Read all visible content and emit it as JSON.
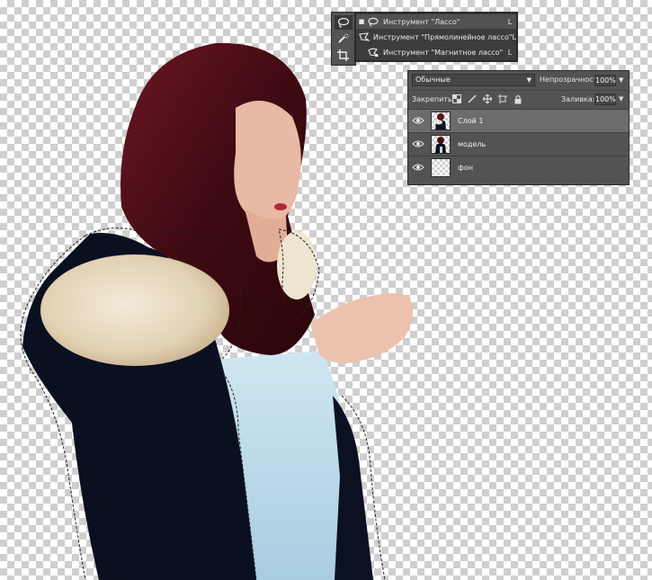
{
  "colors": {
    "panel_bg": "#535353",
    "flyout_bg": "#3c3c3c",
    "selected_layer_bg": "#6c6c6c",
    "text": "#e6e6e6"
  },
  "tool_strip": {
    "tools": [
      {
        "icon": "lasso-icon",
        "active": true
      },
      {
        "icon": "quick-selection-brush-icon",
        "active": false
      },
      {
        "icon": "crop-icon",
        "active": false
      }
    ]
  },
  "flyout": {
    "items": [
      {
        "label": "Инструмент \"Лассо\"",
        "shortcut": "L",
        "icon": "lasso-icon",
        "selected": true,
        "bullet": "■"
      },
      {
        "label": "Инструмент \"Прямолинейное лассо\"",
        "shortcut": "L",
        "icon": "polygonal-lasso-icon",
        "selected": false,
        "bullet": ""
      },
      {
        "label": "Инструмент \"Магнитное лассо\"",
        "shortcut": "L",
        "icon": "magnetic-lasso-icon",
        "selected": false,
        "bullet": ""
      }
    ]
  },
  "layers_panel": {
    "blend_mode": "Обычные",
    "opacity_label": "Непрозрачность:",
    "opacity_value": "100%",
    "lock_label": "Закрепить:",
    "fill_label": "Заливка:",
    "fill_value": "100%",
    "layers": [
      {
        "name": "Слой 1",
        "selected": true,
        "thumb": "figure"
      },
      {
        "name": "модель",
        "selected": false,
        "thumb": "figure-dark"
      },
      {
        "name": "фон",
        "selected": false,
        "thumb": "transparent"
      }
    ]
  }
}
